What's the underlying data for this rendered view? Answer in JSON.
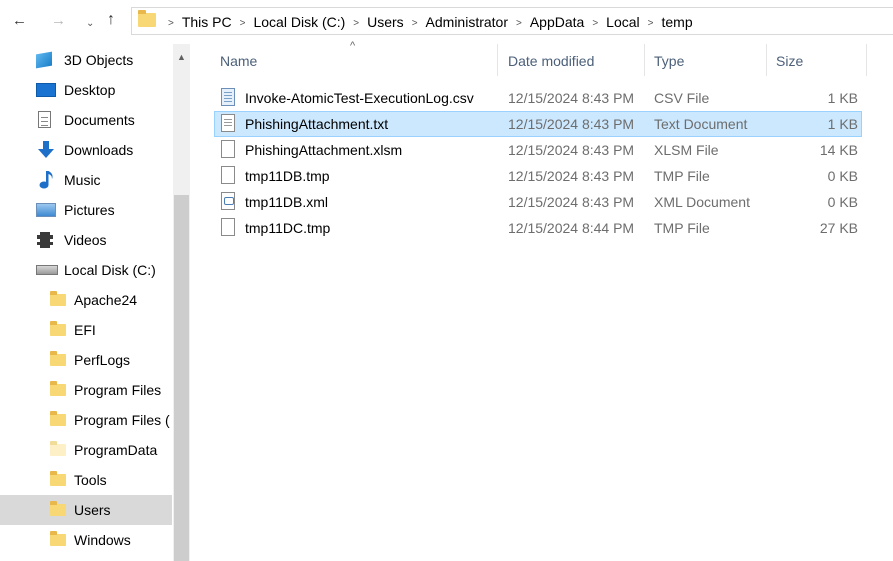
{
  "address": {
    "crumbs": [
      "This PC",
      "Local Disk (C:)",
      "Users",
      "Administrator",
      "AppData",
      "Local",
      "temp"
    ],
    "back_icon": "←",
    "forward_icon": "→",
    "recent_icon": "⌄",
    "up_icon": "↑"
  },
  "nav": {
    "items": [
      {
        "label": "3D Objects",
        "icon": "3d-objects-icon"
      },
      {
        "label": "Desktop",
        "icon": "desktop-icon"
      },
      {
        "label": "Documents",
        "icon": "documents-icon"
      },
      {
        "label": "Downloads",
        "icon": "downloads-icon"
      },
      {
        "label": "Music",
        "icon": "music-icon"
      },
      {
        "label": "Pictures",
        "icon": "pictures-icon"
      },
      {
        "label": "Videos",
        "icon": "videos-icon"
      },
      {
        "label": "Local Disk (C:)",
        "icon": "drive-icon"
      },
      {
        "label": "Apache24",
        "icon": "folder-icon"
      },
      {
        "label": "EFI",
        "icon": "folder-icon"
      },
      {
        "label": "PerfLogs",
        "icon": "folder-icon"
      },
      {
        "label": "Program Files",
        "icon": "folder-icon"
      },
      {
        "label": "Program Files (",
        "icon": "folder-icon"
      },
      {
        "label": "ProgramData",
        "icon": "folder-icon"
      },
      {
        "label": "Tools",
        "icon": "folder-icon"
      },
      {
        "label": "Users",
        "icon": "folder-icon",
        "selected": true
      },
      {
        "label": "Windows",
        "icon": "folder-icon"
      }
    ]
  },
  "columns": {
    "name": "Name",
    "date": "Date modified",
    "type": "Type",
    "size": "Size"
  },
  "files": [
    {
      "name": "Invoke-AtomicTest-ExecutionLog.csv",
      "date": "12/15/2024 8:43 PM",
      "type": "CSV File",
      "size": "1 KB",
      "icon": "csv-file-icon"
    },
    {
      "name": "PhishingAttachment.txt",
      "date": "12/15/2024 8:43 PM",
      "type": "Text Document",
      "size": "1 KB",
      "icon": "text-file-icon",
      "selected": true
    },
    {
      "name": "PhishingAttachment.xlsm",
      "date": "12/15/2024 8:43 PM",
      "type": "XLSM File",
      "size": "14 KB",
      "icon": "blank-file-icon"
    },
    {
      "name": "tmp11DB.tmp",
      "date": "12/15/2024 8:43 PM",
      "type": "TMP File",
      "size": "0 KB",
      "icon": "blank-file-icon"
    },
    {
      "name": "tmp11DB.xml",
      "date": "12/15/2024 8:43 PM",
      "type": "XML Document",
      "size": "0 KB",
      "icon": "xml-file-icon"
    },
    {
      "name": "tmp11DC.tmp",
      "date": "12/15/2024 8:44 PM",
      "type": "TMP File",
      "size": "27 KB",
      "icon": "blank-file-icon"
    }
  ]
}
